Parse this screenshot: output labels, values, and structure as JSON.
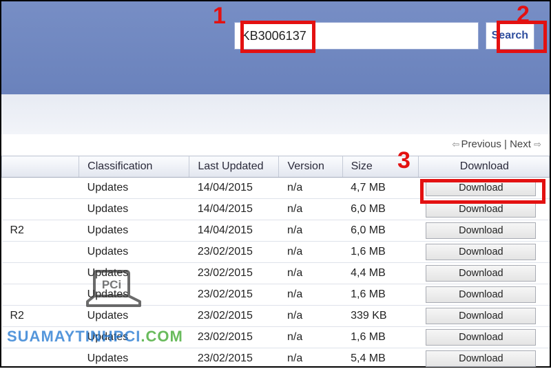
{
  "search": {
    "value": "KB3006137",
    "buttonLabel": "Search"
  },
  "pager": {
    "prev": "Previous",
    "sep": " | ",
    "next": "Next"
  },
  "headers": {
    "first": "",
    "classification": "Classification",
    "lastUpdated": "Last Updated",
    "version": "Version",
    "size": "Size",
    "download": "Download"
  },
  "rows": [
    {
      "first": "",
      "classification": "Updates",
      "lastUpdated": "14/04/2015",
      "version": "n/a",
      "size": "4,7 MB",
      "download": "Download"
    },
    {
      "first": "",
      "classification": "Updates",
      "lastUpdated": "14/04/2015",
      "version": "n/a",
      "size": "6,0 MB",
      "download": "Download"
    },
    {
      "first": "R2",
      "classification": "Updates",
      "lastUpdated": "14/04/2015",
      "version": "n/a",
      "size": "6,0 MB",
      "download": "Download"
    },
    {
      "first": "",
      "classification": "Updates",
      "lastUpdated": "23/02/2015",
      "version": "n/a",
      "size": "1,6 MB",
      "download": "Download"
    },
    {
      "first": "",
      "classification": "Updates",
      "lastUpdated": "23/02/2015",
      "version": "n/a",
      "size": "4,4 MB",
      "download": "Download"
    },
    {
      "first": "",
      "classification": "Updates",
      "lastUpdated": "23/02/2015",
      "version": "n/a",
      "size": "1,6 MB",
      "download": "Download"
    },
    {
      "first": "R2",
      "classification": "Updates",
      "lastUpdated": "23/02/2015",
      "version": "n/a",
      "size": "339 KB",
      "download": "Download"
    },
    {
      "first": "",
      "classification": "Updates",
      "lastUpdated": "23/02/2015",
      "version": "n/a",
      "size": "1,6 MB",
      "download": "Download"
    },
    {
      "first": "",
      "classification": "Updates",
      "lastUpdated": "23/02/2015",
      "version": "n/a",
      "size": "5,4 MB",
      "download": "Download"
    }
  ],
  "annotations": {
    "n1": "1",
    "n2": "2",
    "n3": "3"
  },
  "watermark": {
    "pci": "PCi",
    "url_part1": "SUAMAYTINHPCI",
    "url_dot": ".",
    "url_part2": "COM"
  }
}
